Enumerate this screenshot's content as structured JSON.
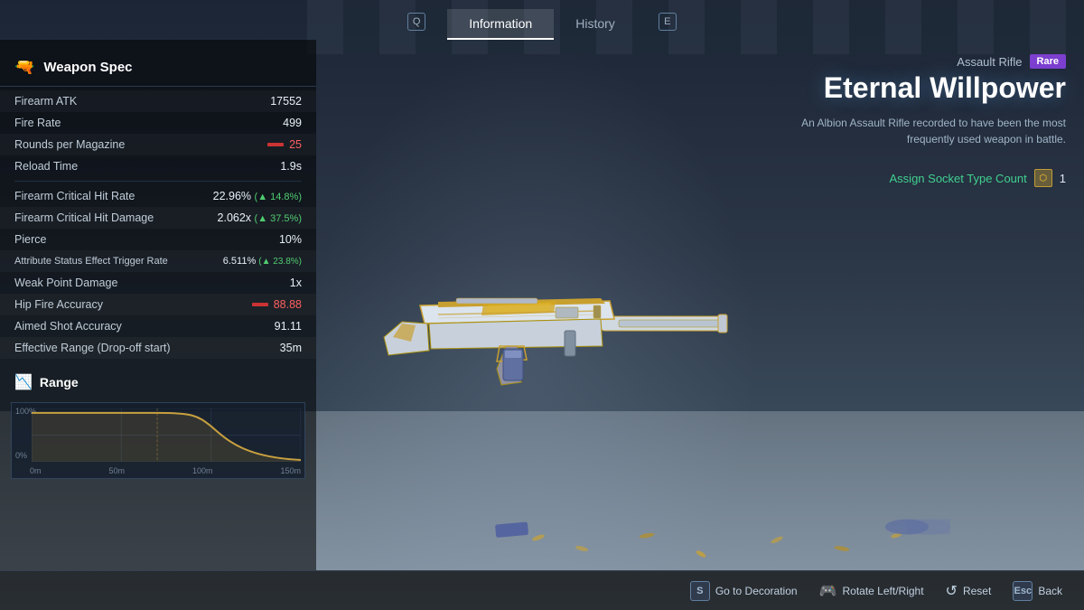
{
  "tabs": {
    "q_key": "Q",
    "information_label": "Information",
    "history_label": "History",
    "e_key": "E"
  },
  "weapon_spec": {
    "section_title": "Weapon Spec",
    "stats": [
      {
        "name": "Firearm ATK",
        "value": "17552",
        "type": "plain"
      },
      {
        "name": "Fire Rate",
        "value": "499",
        "type": "plain"
      },
      {
        "name": "Rounds per Magazine",
        "value": "25",
        "type": "bar"
      },
      {
        "name": "Reload Time",
        "value": "1.9s",
        "type": "plain"
      },
      {
        "name": "Firearm Critical Hit Rate",
        "value": "22.96%",
        "bonus": "▲ 14.8%",
        "type": "bonus"
      },
      {
        "name": "Firearm Critical Hit Damage",
        "value": "2.062x",
        "bonus": "▲ 37.5%",
        "type": "bonus"
      },
      {
        "name": "Pierce",
        "value": "10%",
        "type": "plain"
      },
      {
        "name": "Attribute Status Effect Trigger Rate",
        "value": "6.511%",
        "bonus": "▲ 23.8%",
        "type": "bonus"
      },
      {
        "name": "Weak Point Damage",
        "value": "1x",
        "type": "plain"
      },
      {
        "name": "Hip Fire Accuracy",
        "value": "88.88",
        "type": "red_bar"
      },
      {
        "name": "Aimed Shot Accuracy",
        "value": "91.11",
        "type": "plain"
      },
      {
        "name": "Effective Range (Drop-off start)",
        "value": "35m",
        "type": "plain"
      }
    ]
  },
  "range_section": {
    "title": "Range",
    "y_labels": [
      "100%",
      "0%"
    ],
    "x_labels": [
      "0m",
      "50m",
      "100m",
      "150m"
    ]
  },
  "weapon_info": {
    "type": "Assault Rifle",
    "rarity": "Rare",
    "name": "Eternal Willpower",
    "description": "An Albion Assault Rifle recorded to have been the most\nfrequently used weapon in battle.",
    "socket_label": "Assign Socket Type Count",
    "socket_count": "1"
  },
  "bottom_bar": {
    "decoration_key": "S",
    "decoration_label": "Go to Decoration",
    "rotate_label": "Rotate Left/Right",
    "reset_label": "Reset",
    "back_key": "Esc",
    "back_label": "Back"
  }
}
